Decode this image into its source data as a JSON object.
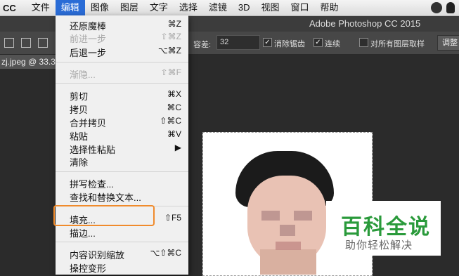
{
  "menubar": {
    "app": "CC",
    "items": [
      "文件",
      "编辑",
      "图像",
      "图层",
      "文字",
      "选择",
      "滤镜",
      "3D",
      "视图",
      "窗口",
      "帮助"
    ],
    "active_index": 1
  },
  "titlebar": {
    "title": "Adobe Photoshop CC 2015"
  },
  "options": {
    "tolerance_label": "容差:",
    "tolerance_value": "32",
    "antialias_label": "消除锯齿",
    "contiguous_label": "连续",
    "all_layers_label": "对所有图层取样",
    "adjust_label": "调整",
    "check_mark": "✓"
  },
  "doc_tab": {
    "label": "zj.jpeg @ 33.3"
  },
  "edit_menu": {
    "items": [
      {
        "label": "还原魔棒",
        "shortcut": "⌘Z",
        "disabled": false
      },
      {
        "label": "前进一步",
        "shortcut": "⇧⌘Z",
        "disabled": true
      },
      {
        "label": "后退一步",
        "shortcut": "⌥⌘Z",
        "disabled": false
      },
      {
        "label": "渐隐...",
        "shortcut": "⇧⌘F",
        "disabled": true
      },
      {
        "label": "剪切",
        "shortcut": "⌘X",
        "disabled": false
      },
      {
        "label": "拷贝",
        "shortcut": "⌘C",
        "disabled": false
      },
      {
        "label": "合并拷贝",
        "shortcut": "⇧⌘C",
        "disabled": false
      },
      {
        "label": "粘贴",
        "shortcut": "⌘V",
        "disabled": false
      },
      {
        "label": "选择性粘贴",
        "shortcut": "▶",
        "disabled": false
      },
      {
        "label": "清除",
        "shortcut": "",
        "disabled": false
      },
      {
        "label": "拼写检查...",
        "shortcut": "",
        "disabled": false
      },
      {
        "label": "查找和替换文本...",
        "shortcut": "",
        "disabled": false
      },
      {
        "label": "填充...",
        "shortcut": "⇧F5",
        "disabled": false
      },
      {
        "label": "描边...",
        "shortcut": "",
        "disabled": false
      },
      {
        "label": "内容识别缩放",
        "shortcut": "⌥⇧⌘C",
        "disabled": false
      },
      {
        "label": "操控变形",
        "shortcut": "",
        "disabled": false
      }
    ]
  },
  "watermark": {
    "title": "百科全说",
    "subtitle": "助你轻松解决"
  }
}
